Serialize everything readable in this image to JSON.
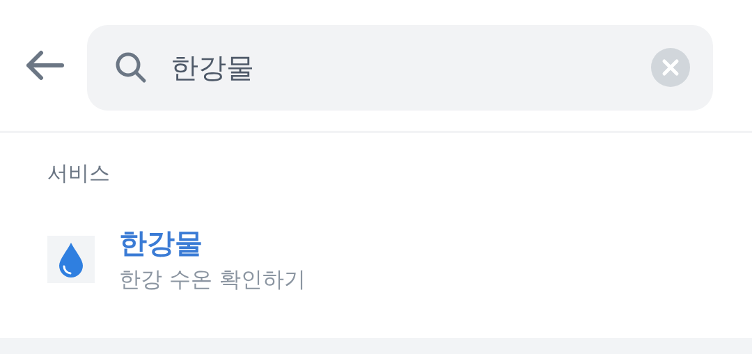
{
  "search": {
    "value": "한강물"
  },
  "section": {
    "title": "서비스",
    "items": [
      {
        "title": "한강물",
        "subtitle": "한강 수온 확인하기"
      }
    ]
  }
}
